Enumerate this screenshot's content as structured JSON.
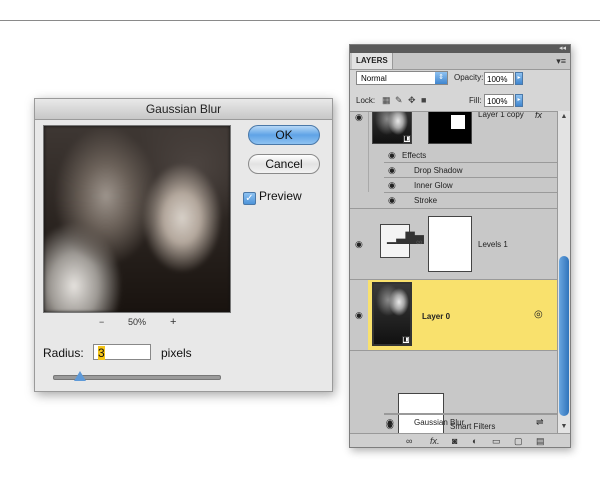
{
  "dialog": {
    "title": "Gaussian Blur",
    "ok_label": "OK",
    "cancel_label": "Cancel",
    "preview_label": "Preview",
    "preview_checked": true,
    "zoom_minus": "−",
    "zoom_level": "50%",
    "zoom_plus": "+",
    "radius_label": "Radius:",
    "radius_value": "3",
    "radius_units": "pixels",
    "radius_slider_fraction": 0.12
  },
  "layers_panel": {
    "tab_label": "LAYERS",
    "blend_mode": "Normal",
    "opacity_label": "Opacity:",
    "opacity_value": "100%",
    "lock_label": "Lock:",
    "fill_label": "Fill:",
    "fill_value": "100%",
    "layers": [
      {
        "name": "Layer 1 copy",
        "fx": "fx"
      },
      {
        "name": "Levels 1"
      },
      {
        "name": "Layer 0",
        "selected": true,
        "highlight_color": "#f9e16d"
      },
      {
        "name": "Smart Filters"
      },
      {
        "name": "Gaussian Blur"
      }
    ],
    "effects_label": "Effects",
    "effects": [
      "Drop Shadow",
      "Inner Glow",
      "Stroke"
    ],
    "accent_color": "#3f86cf"
  }
}
